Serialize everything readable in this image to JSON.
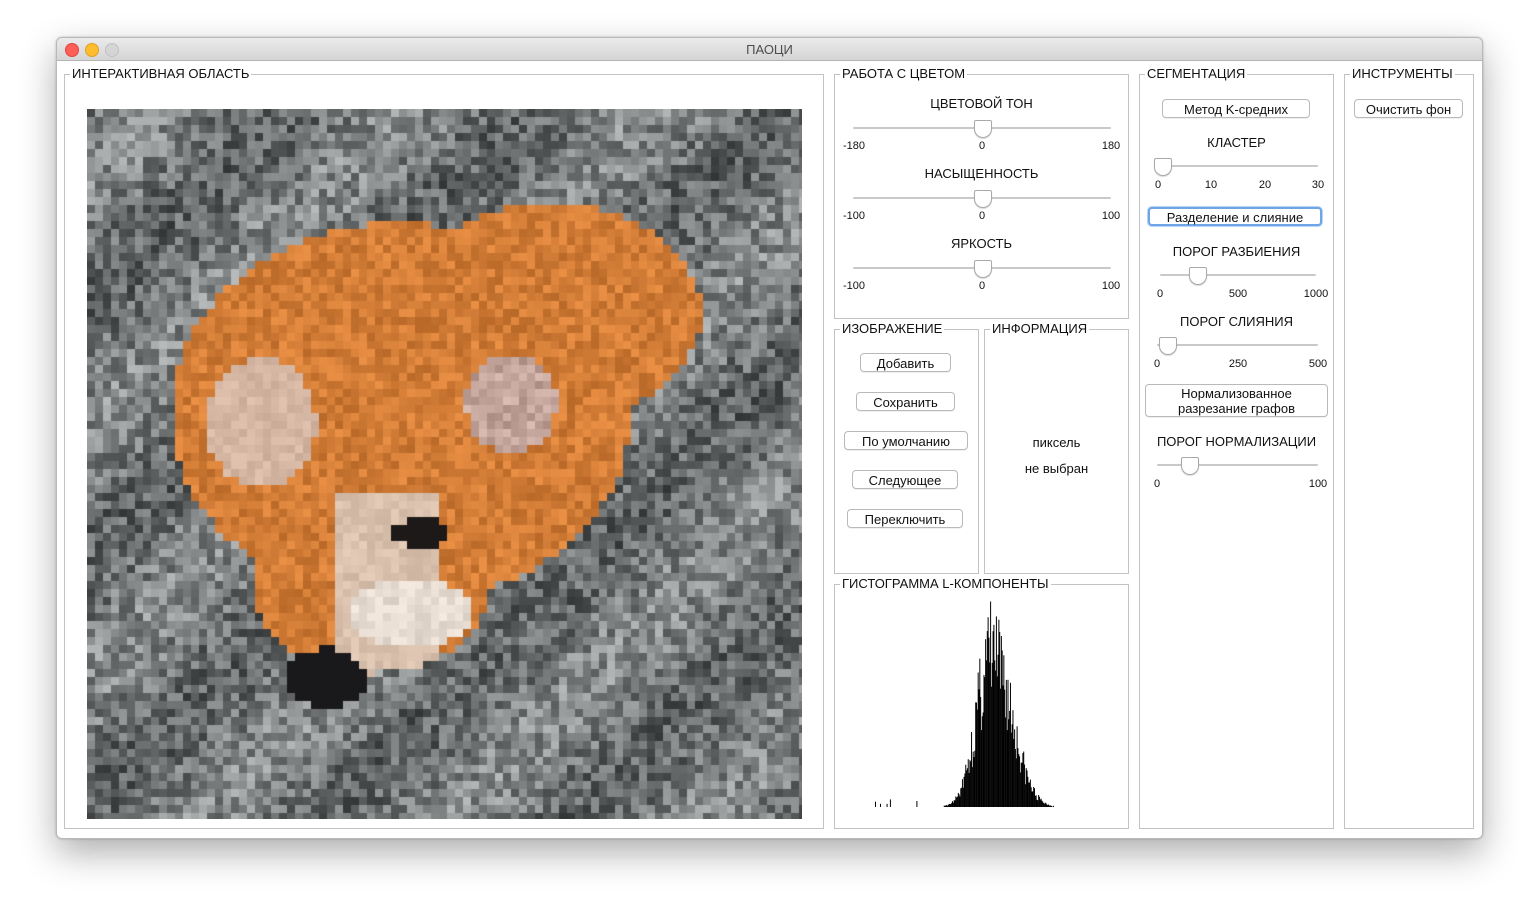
{
  "window": {
    "title": "ПАОЦИ"
  },
  "interactive": {
    "title": "ИНТЕРАКТИВНАЯ ОБЛАСТЬ",
    "image": {
      "description": "pixelated photo of a shiba inu dog lying on a grey blanket"
    }
  },
  "color": {
    "title": "РАБОТА С ЦВЕТОМ",
    "sliders": [
      {
        "label": "ЦВЕТОВОЙ ТОН",
        "min": "-180",
        "mid": "0",
        "max": "180",
        "value": 0.5
      },
      {
        "label": "НАСЫЩЕННОСТЬ",
        "min": "-100",
        "mid": "0",
        "max": "100",
        "value": 0.5
      },
      {
        "label": "ЯРКОСТЬ",
        "min": "-100",
        "mid": "0",
        "max": "100",
        "value": 0.5
      }
    ]
  },
  "image": {
    "title": "ИЗОБРАЖЕНИЕ",
    "buttons": [
      "Добавить",
      "Сохранить",
      "По умолчанию",
      "Следующее",
      "Переключить"
    ]
  },
  "info": {
    "title": "ИНФОРМАЦИЯ",
    "line1": "пиксель",
    "line2": "не выбран"
  },
  "histogram": {
    "title": "ГИСТОГРАММА L-КОМПОНЕНТЫ",
    "color": "#000000"
  },
  "segmentation": {
    "title": "СЕГМЕНТАЦИЯ",
    "kmeans_button": "Метод K-средних",
    "cluster": {
      "label": "КЛАСТЕР",
      "ticks": [
        "0",
        "10",
        "20",
        "30"
      ],
      "value": 0
    },
    "split_merge_button": "Разделение и слияние",
    "split": {
      "label": "ПОРОГ РАЗБИЕНИЯ",
      "ticks": [
        "0",
        "500",
        "1000"
      ],
      "value": 0.24
    },
    "merge": {
      "label": "ПОРОГ СЛИЯНИЯ",
      "ticks": [
        "0",
        "250",
        "500"
      ],
      "value": 0.06
    },
    "ncut_button": "Нормализованное разрезание графов",
    "ncut_button_line1": "Нормализованное",
    "ncut_button_line2": "разрезание графов",
    "norm": {
      "label": "ПОРОГ НОРМАЛИЗАЦИИ",
      "ticks": [
        "0",
        "100"
      ],
      "value": 0.2
    }
  },
  "tools": {
    "title": "ИНСТРУМЕНТЫ",
    "clear_bg_button": "Очистить фон"
  },
  "colors": {
    "focus_ring": "#6ea5e6",
    "close": "#fd5f57",
    "minimize": "#febc2e",
    "fur_orange": "#c8823c"
  }
}
